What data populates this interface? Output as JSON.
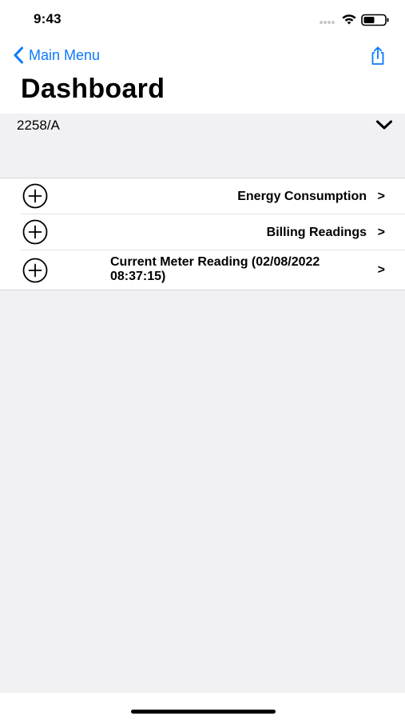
{
  "status_bar": {
    "time": "9:43"
  },
  "nav": {
    "back_label": "Main Menu",
    "back_icon": "chevron-left-icon",
    "share_icon": "share-icon"
  },
  "page": {
    "title": "Dashboard"
  },
  "meter": {
    "selected_id": "2258/A",
    "dropdown_icon": "chevron-down-icon"
  },
  "menu": {
    "items": [
      {
        "label": "Energy Consumption",
        "arrow": ">",
        "icon": "plus-circle-icon"
      },
      {
        "label": "Billing Readings",
        "arrow": ">",
        "icon": "plus-circle-icon"
      },
      {
        "label": "Current Meter Reading (02/08/2022 08:37:15)",
        "arrow": ">",
        "icon": "plus-circle-icon"
      }
    ]
  },
  "colors": {
    "accent": "#0a7aff",
    "background_grouped": "#f1f1f4",
    "separator": "#d8d8dc"
  }
}
